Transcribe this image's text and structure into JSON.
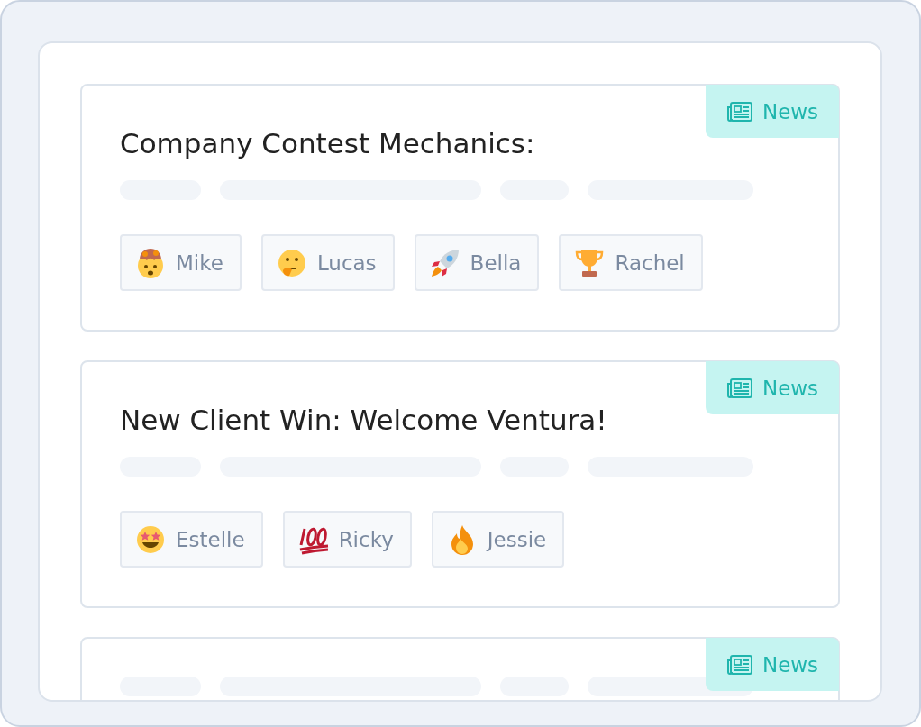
{
  "cards": [
    {
      "tag": "News",
      "title": "Company Contest Mechanics:",
      "reactions": [
        {
          "kind": "exploding-head",
          "name": "Mike"
        },
        {
          "kind": "thinking",
          "name": "Lucas"
        },
        {
          "kind": "rocket",
          "name": "Bella"
        },
        {
          "kind": "trophy",
          "name": "Rachel"
        }
      ]
    },
    {
      "tag": "News",
      "title": "New Client Win: Welcome Ventura!",
      "reactions": [
        {
          "kind": "star-struck",
          "name": "Estelle"
        },
        {
          "kind": "hundred",
          "name": "Ricky"
        },
        {
          "kind": "fire",
          "name": "Jessie"
        }
      ]
    },
    {
      "tag": "News"
    }
  ]
}
